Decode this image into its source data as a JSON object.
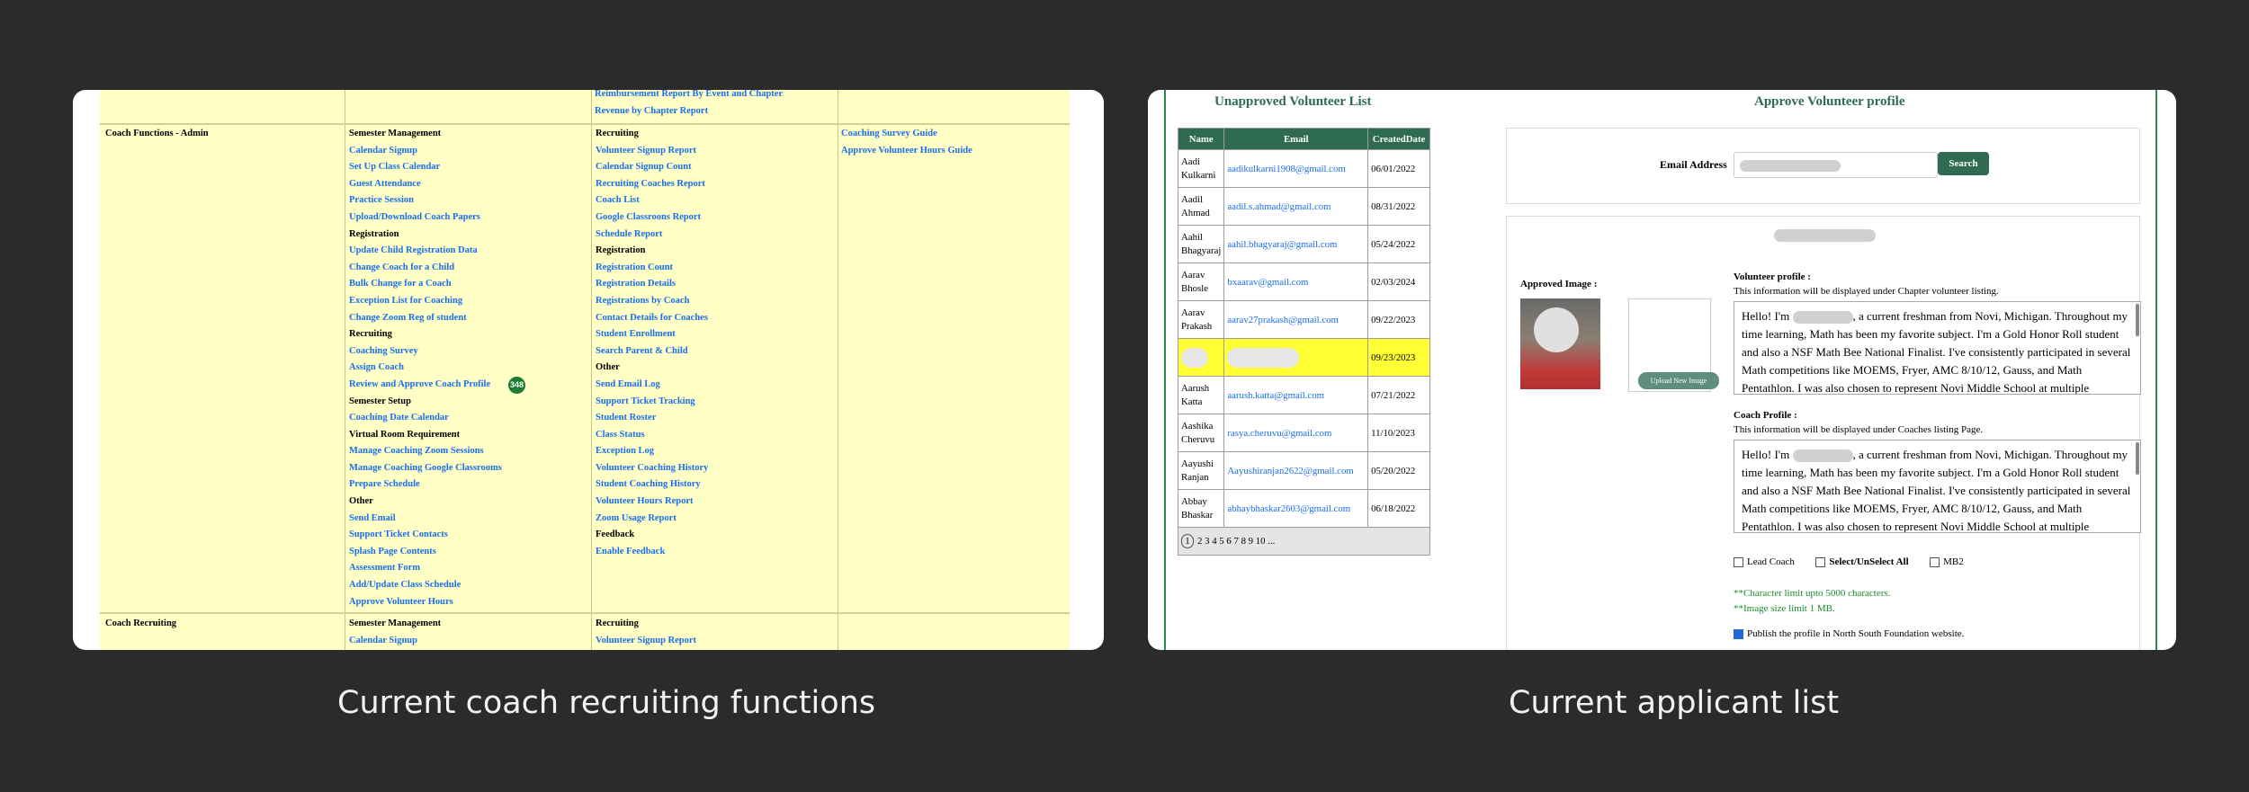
{
  "left": {
    "top_partial_links": [
      "Reimbursement Report By Event and Chapter",
      "Revenue by Chapter Report"
    ],
    "section_title": "Coach Functions - Admin",
    "col2": [
      {
        "t": "h",
        "v": "Semester Management"
      },
      {
        "t": "l",
        "v": "Calendar Signup"
      },
      {
        "t": "l",
        "v": "Set Up Class Calendar"
      },
      {
        "t": "l",
        "v": "Guest Attendance"
      },
      {
        "t": "l",
        "v": "Practice Session"
      },
      {
        "t": "l",
        "v": "Upload/Download Coach Papers"
      },
      {
        "t": "h",
        "v": "Registration"
      },
      {
        "t": "l",
        "v": "Update Child Registration Data"
      },
      {
        "t": "l",
        "v": "Change Coach for a Child"
      },
      {
        "t": "l",
        "v": "Bulk Change for a Coach"
      },
      {
        "t": "l",
        "v": "Exception List for Coaching"
      },
      {
        "t": "l",
        "v": "Change Zoom Reg of student"
      },
      {
        "t": "h",
        "v": "Recruiting"
      },
      {
        "t": "l",
        "v": "Coaching Survey"
      },
      {
        "t": "l",
        "v": "Assign Coach"
      },
      {
        "t": "l",
        "v": "Review and Approve Coach Profile",
        "badge": "348"
      },
      {
        "t": "h",
        "v": "Semester Setup"
      },
      {
        "t": "l",
        "v": "Coaching Date Calendar"
      },
      {
        "t": "h",
        "v": "Virtual Room Requirement"
      },
      {
        "t": "l",
        "v": "Manage Coaching Zoom Sessions"
      },
      {
        "t": "l",
        "v": "Manage Coaching Google Classrooms"
      },
      {
        "t": "l",
        "v": "Prepare Schedule"
      },
      {
        "t": "h",
        "v": "Other"
      },
      {
        "t": "l",
        "v": "Send Email"
      },
      {
        "t": "l",
        "v": "Support Ticket Contacts"
      },
      {
        "t": "l",
        "v": "Splash Page Contents"
      },
      {
        "t": "l",
        "v": "Assessment Form"
      },
      {
        "t": "l",
        "v": "Add/Update Class Schedule"
      },
      {
        "t": "l",
        "v": "Approve Volunteer Hours"
      }
    ],
    "col3": [
      {
        "t": "h",
        "v": "Recruiting"
      },
      {
        "t": "l",
        "v": "Volunteer Signup Report"
      },
      {
        "t": "l",
        "v": "Calendar Signup Count"
      },
      {
        "t": "l",
        "v": "Recruiting Coaches Report"
      },
      {
        "t": "l",
        "v": "Coach List"
      },
      {
        "t": "l",
        "v": "Google Classroons Report"
      },
      {
        "t": "l",
        "v": "Schedule Report"
      },
      {
        "t": "h",
        "v": "Registration"
      },
      {
        "t": "l",
        "v": "Registration Count"
      },
      {
        "t": "l",
        "v": "Registration Details"
      },
      {
        "t": "l",
        "v": "Registrations by Coach"
      },
      {
        "t": "l",
        "v": "Contact Details for Coaches"
      },
      {
        "t": "l",
        "v": "Student Enrollment"
      },
      {
        "t": "l",
        "v": "Search Parent & Child"
      },
      {
        "t": "h",
        "v": "Other"
      },
      {
        "t": "l",
        "v": "Send Email Log"
      },
      {
        "t": "l",
        "v": "Support Ticket Tracking"
      },
      {
        "t": "l",
        "v": "Student Roster"
      },
      {
        "t": "l",
        "v": "Class Status"
      },
      {
        "t": "l",
        "v": "Exception Log"
      },
      {
        "t": "l",
        "v": "Volunteer Coaching History"
      },
      {
        "t": "l",
        "v": "Student Coaching History"
      },
      {
        "t": "l",
        "v": "Volunteer Hours Report"
      },
      {
        "t": "l",
        "v": "Zoom Usage Report"
      },
      {
        "t": "h",
        "v": "Feedback"
      },
      {
        "t": "l",
        "v": "Enable Feedback"
      }
    ],
    "col4": [
      {
        "t": "l",
        "v": "Coaching Survey Guide"
      },
      {
        "t": "l",
        "v": "Approve Volunteer Hours Guide"
      }
    ],
    "bottom": {
      "section_title": "Coach Recruiting",
      "col2_header": "Semester Management",
      "col2_link": "Calendar Signup",
      "col3_header": "Recruiting",
      "col3_link": "Volunteer Signup Report"
    }
  },
  "right": {
    "list_title": "Unapproved Volunteer List",
    "profile_title": "Approve Volunteer profile",
    "headers": [
      "Name",
      "Email",
      "CreatedDate"
    ],
    "rows": [
      {
        "name": "Aadi Kulkarni",
        "email": "aadikulkarni1908@gmail.com",
        "date": "06/01/2022"
      },
      {
        "name": "Aadil Ahmad",
        "email": "aadil.s.ahmad@gmail.com",
        "date": "08/31/2022"
      },
      {
        "name": "Aahil Bhagyaraj",
        "email": "aahil.bhagyaraj@gmail.com",
        "date": "05/24/2022"
      },
      {
        "name": "Aarav Bhosle",
        "email": "bxaarav@gmail.com",
        "date": "02/03/2024"
      },
      {
        "name": "Aarav Prakash",
        "email": "aarav27prakash@gmail.com",
        "date": "09/22/2023"
      },
      {
        "name": "",
        "email": "",
        "date": "09/23/2023",
        "hl": true
      },
      {
        "name": "Aarush Katta",
        "email": "aarush.katta@gmail.com",
        "date": "07/21/2022"
      },
      {
        "name": "Aashika Cheruvu",
        "email": "rasya.cheruvu@gmail.com",
        "date": "11/10/2023"
      },
      {
        "name": "Aayushi Ranjan",
        "email": "Aayushiranjan2622@gmail.com",
        "date": "05/20/2022"
      },
      {
        "name": "Abbay Bhaskar",
        "email": "abhaybhaskar2603@gmail.com",
        "date": "06/18/2022"
      }
    ],
    "pages": "2 3 4 5 6 7 8 9 10 ...",
    "current_page": "1",
    "email_label": "Email Address",
    "search_label": "Search",
    "approved_image_label": "Approved Image :",
    "upload_label": "Upload New Image",
    "volunteer_profile_label": "Volunteer profile :",
    "volunteer_profile_note": "This information will be displayed under Chapter volunteer listing.",
    "profile_text_pre": "Hello! I'm",
    "profile_text_post": ", a current freshman from Novi, Michigan. Throughout my time learning, Math has been my favorite subject. I'm a Gold Honor Roll student and also a NSF Math Bee National Finalist. I've consistently participated in several Math competitions like MOEMS, Fryer, AMC 8/10/12, Gauss, and Math Pentathlon. I was also chosen to represent Novi Middle School at multiple",
    "coach_profile_label": "Coach Profile :",
    "coach_profile_note": "This information will be displayed under Coaches listing Page.",
    "lead_coach": "Lead Coach",
    "select_all": "Select/UnSelect All",
    "mb2": "MB2",
    "note1": "**Character limit upto 5000 characters.",
    "note2": "**Image size limit 1 MB.",
    "publish": "Publish the profile in North South Foundation website."
  },
  "captions": {
    "left": "Current coach recruiting functions",
    "right": "Current applicant list"
  }
}
